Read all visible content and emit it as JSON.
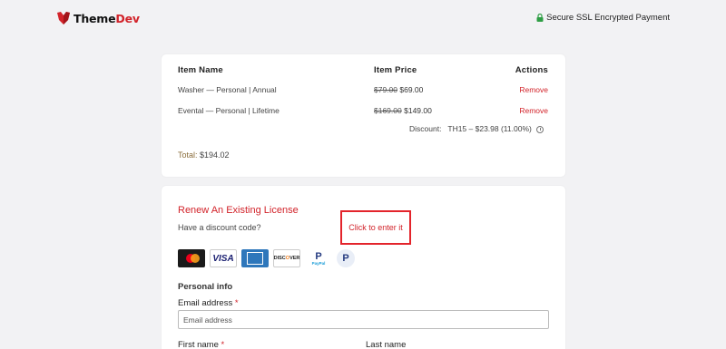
{
  "brand": {
    "name_part1": "Theme",
    "name_part2": "Dev",
    "accent": "#d2232a",
    "icon": "shield-logo-icon"
  },
  "secure": {
    "label": "Secure SSL Encrypted Payment",
    "icon": "lock-icon",
    "icon_color": "#2e9e44"
  },
  "cart": {
    "headers": {
      "name": "Item Name",
      "price": "Item Price",
      "actions": "Actions"
    },
    "items": [
      {
        "name": "Washer — Personal | Annual",
        "old_price": "$79.00",
        "new_price": "$69.00",
        "action": "Remove"
      },
      {
        "name": "Evental — Personal | Lifetime",
        "old_price": "$169.00",
        "new_price": "$149.00",
        "action": "Remove"
      }
    ],
    "discount": {
      "label": "Discount:",
      "value": "TH15 – $23.98 (11.00%)"
    },
    "total": {
      "label": "Total:",
      "value": "$194.02"
    }
  },
  "form": {
    "renew_link": "Renew An Existing License",
    "discount_question": "Have a discount code?",
    "discount_link": "Click to enter it",
    "payment_methods": [
      "mastercard",
      "VISA",
      "american-express",
      "DISCOVER",
      "paypal",
      "paypal-icon"
    ],
    "visa_text": "VISA",
    "discover_text_a": "DISC",
    "discover_text_b": "O",
    "discover_text_c": "VER",
    "paypal_text": "PayPal",
    "paypal_letter": "P",
    "personal_info": "Personal info",
    "email_label": "Email address",
    "email_placeholder": "Email address",
    "required_mark": "*",
    "first_name_label": "First name",
    "last_name_label": "Last name"
  }
}
